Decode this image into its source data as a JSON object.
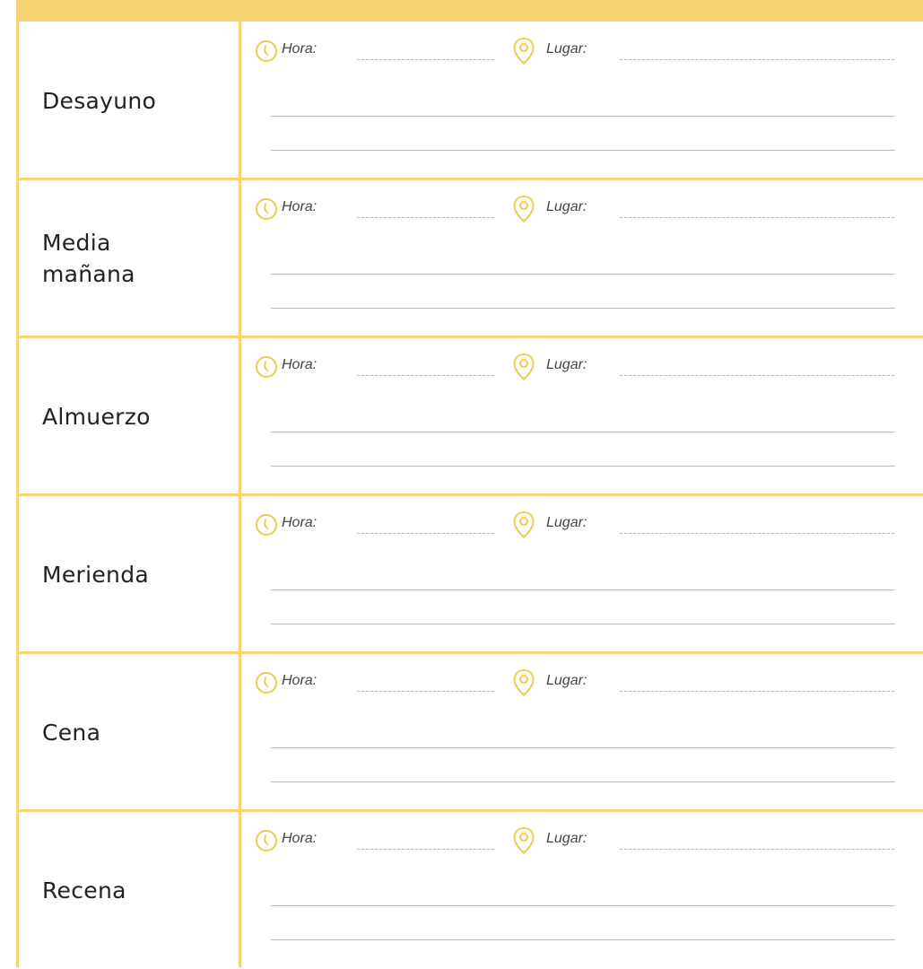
{
  "colors": {
    "accent": "#f8d373",
    "icon": "#f5c94e",
    "rule": "#b9b9b9"
  },
  "fields": {
    "time_label": "Hora:",
    "place_label": "Lugar:"
  },
  "icons": {
    "time": "clock-icon",
    "place": "location-pin-icon"
  },
  "meals": [
    {
      "label": "Desayuno"
    },
    {
      "label": "Media mañana"
    },
    {
      "label": "Almuerzo"
    },
    {
      "label": "Merienda"
    },
    {
      "label": "Cena"
    },
    {
      "label": "Recena"
    }
  ]
}
